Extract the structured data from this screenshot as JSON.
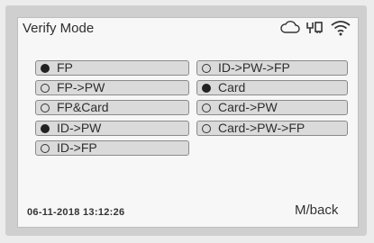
{
  "header": {
    "title": "Verify Mode",
    "status_icons": [
      "cloud-icon",
      "network-icon",
      "wifi-icon"
    ]
  },
  "options": {
    "left": [
      {
        "label": "FP",
        "selected": true
      },
      {
        "label": "FP->PW",
        "selected": false
      },
      {
        "label": "FP&Card",
        "selected": false
      },
      {
        "label": "ID->PW",
        "selected": true
      },
      {
        "label": "ID->FP",
        "selected": false
      }
    ],
    "right": [
      {
        "label": "ID->PW->FP",
        "selected": false
      },
      {
        "label": "Card",
        "selected": true
      },
      {
        "label": "Card->PW",
        "selected": false
      },
      {
        "label": "Card->PW->FP",
        "selected": false
      }
    ]
  },
  "footer": {
    "datetime": "06-11-2018   13:12:26",
    "back_label": "M/back"
  }
}
